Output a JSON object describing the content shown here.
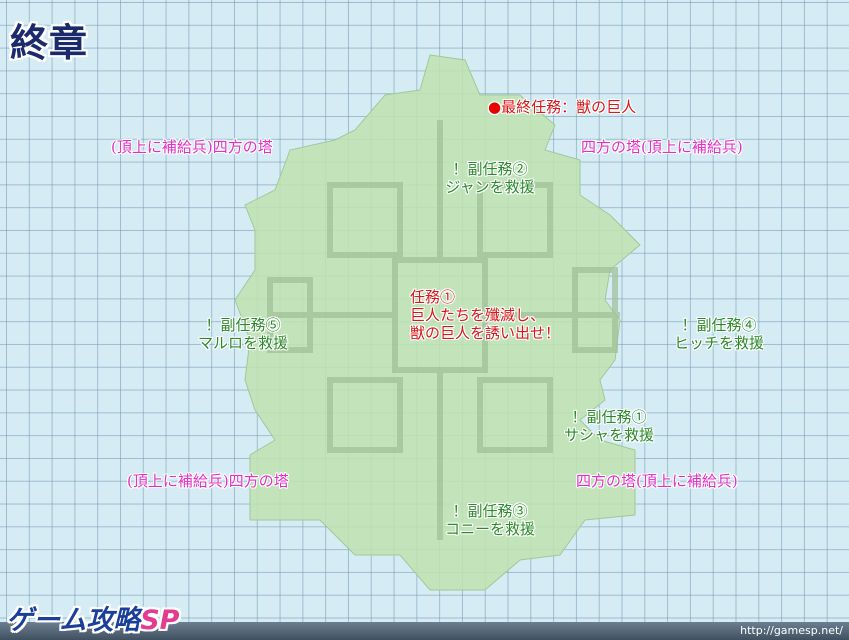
{
  "title": "終章",
  "map": {
    "boss_marker": "●",
    "boss_label": "最終任務：獣の巨人",
    "towers": {
      "top_left": "(頂上に補給兵)四方の塔",
      "top_right": "四方の塔(頂上に補給兵)",
      "bottom_left": "(頂上に補給兵)四方の塔",
      "bottom_right": "四方の塔(頂上に補給兵)"
    },
    "main_mission": [
      "任務①",
      "巨人たちを殲滅し、",
      "獣の巨人を誘い出せ！"
    ],
    "sub_missions": {
      "s1": [
        "！副任務①",
        "サシャを救援"
      ],
      "s2": [
        "！副任務②",
        "ジャンを救援"
      ],
      "s3": [
        "！副任務③",
        "コニーを救援"
      ],
      "s4": [
        "！副任務④",
        "ヒッチを救援"
      ],
      "s5": [
        "！副任務⑤",
        "マルロを救援"
      ]
    }
  },
  "footer": {
    "logo_main": "ゲーム攻略",
    "logo_sp": "SP",
    "url": "http://gamesp.net/"
  },
  "colors": {
    "mission_red": "#d81818",
    "sub_green": "#2b8a2b",
    "tower_pink": "#e030c8",
    "map_green": "#bfe3b0",
    "grid_bg": "#d6ecf4"
  }
}
